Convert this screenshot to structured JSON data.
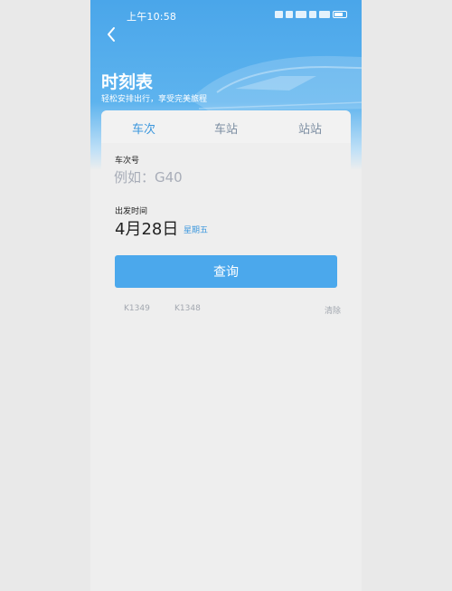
{
  "status_bar": {
    "time": "上午10:58"
  },
  "header": {
    "back_icon": "chevron-left-icon",
    "title": "时刻表",
    "subtitle": "轻松安排出行，享受完美旅程"
  },
  "tabs": [
    {
      "label": "车次",
      "active": true
    },
    {
      "label": "车站",
      "active": false
    },
    {
      "label": "站站",
      "active": false
    }
  ],
  "form": {
    "train_no_label": "车次号",
    "train_no_placeholder": "例如：G40",
    "train_no_value": "",
    "depart_label": "出发时间",
    "date": "4月28日",
    "weekday": "星期五",
    "query_label": "查询"
  },
  "history": {
    "items": [
      "K1349",
      "K1348"
    ],
    "clear_label": "清除"
  },
  "colors": {
    "accent": "#4ba8ec",
    "active_tab": "#3b97dd",
    "muted": "#a3a8b0"
  }
}
